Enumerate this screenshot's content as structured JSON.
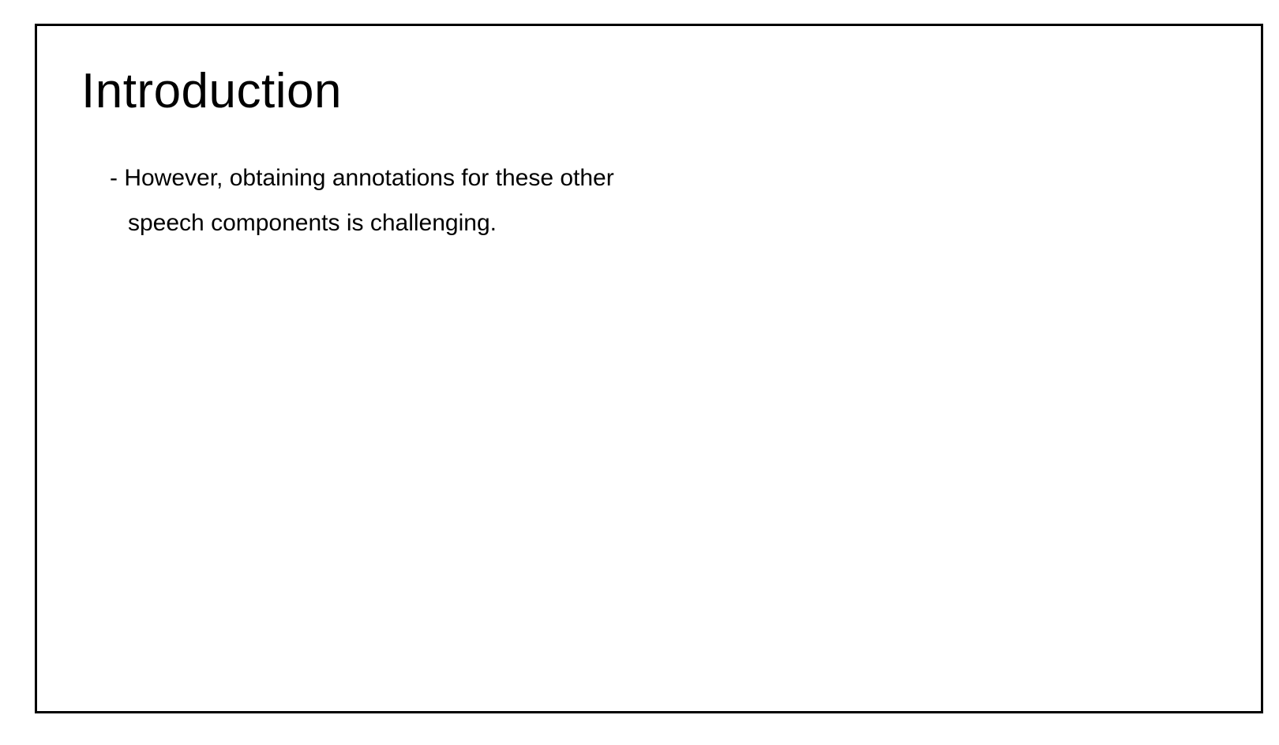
{
  "slide": {
    "title": "Introduction",
    "body_lines": [
      "- However, obtaining annotations for these other",
      "speech components is challenging."
    ]
  }
}
